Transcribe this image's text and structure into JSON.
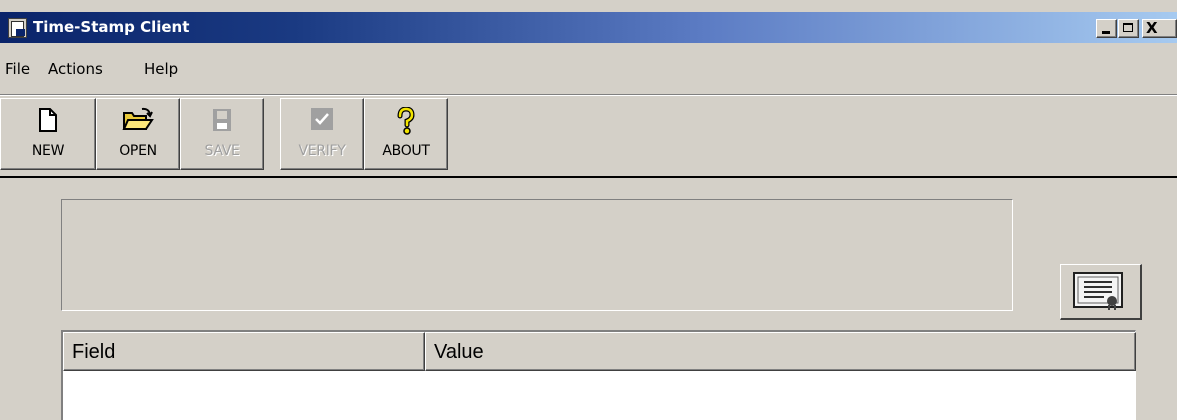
{
  "window": {
    "title": "Time-Stamp Client",
    "app_icon": "certificate-doc-icon",
    "controls": {
      "minimize": "_",
      "maximize": "□",
      "close": "X"
    }
  },
  "menu": [
    {
      "label": "File"
    },
    {
      "label": "Actions"
    },
    {
      "label": "Help"
    }
  ],
  "toolbar": [
    {
      "label": "NEW",
      "icon": "new-document-icon",
      "enabled": true
    },
    {
      "label": "OPEN",
      "icon": "open-folder-icon",
      "enabled": true
    },
    {
      "label": "SAVE",
      "icon": "floppy-disk-icon",
      "enabled": false
    },
    {
      "label": "VERIFY",
      "icon": "checkmark-icon",
      "enabled": false
    },
    {
      "label": "ABOUT",
      "icon": "question-mark-icon",
      "enabled": true
    }
  ],
  "cert_button": {
    "icon": "certificate-icon"
  },
  "table": {
    "columns": [
      "Field",
      "Value"
    ],
    "rows": []
  },
  "colors": {
    "title_bar_start": "#0a246a",
    "title_bar_end": "#a6caf0",
    "face": "#d4d0c8"
  }
}
